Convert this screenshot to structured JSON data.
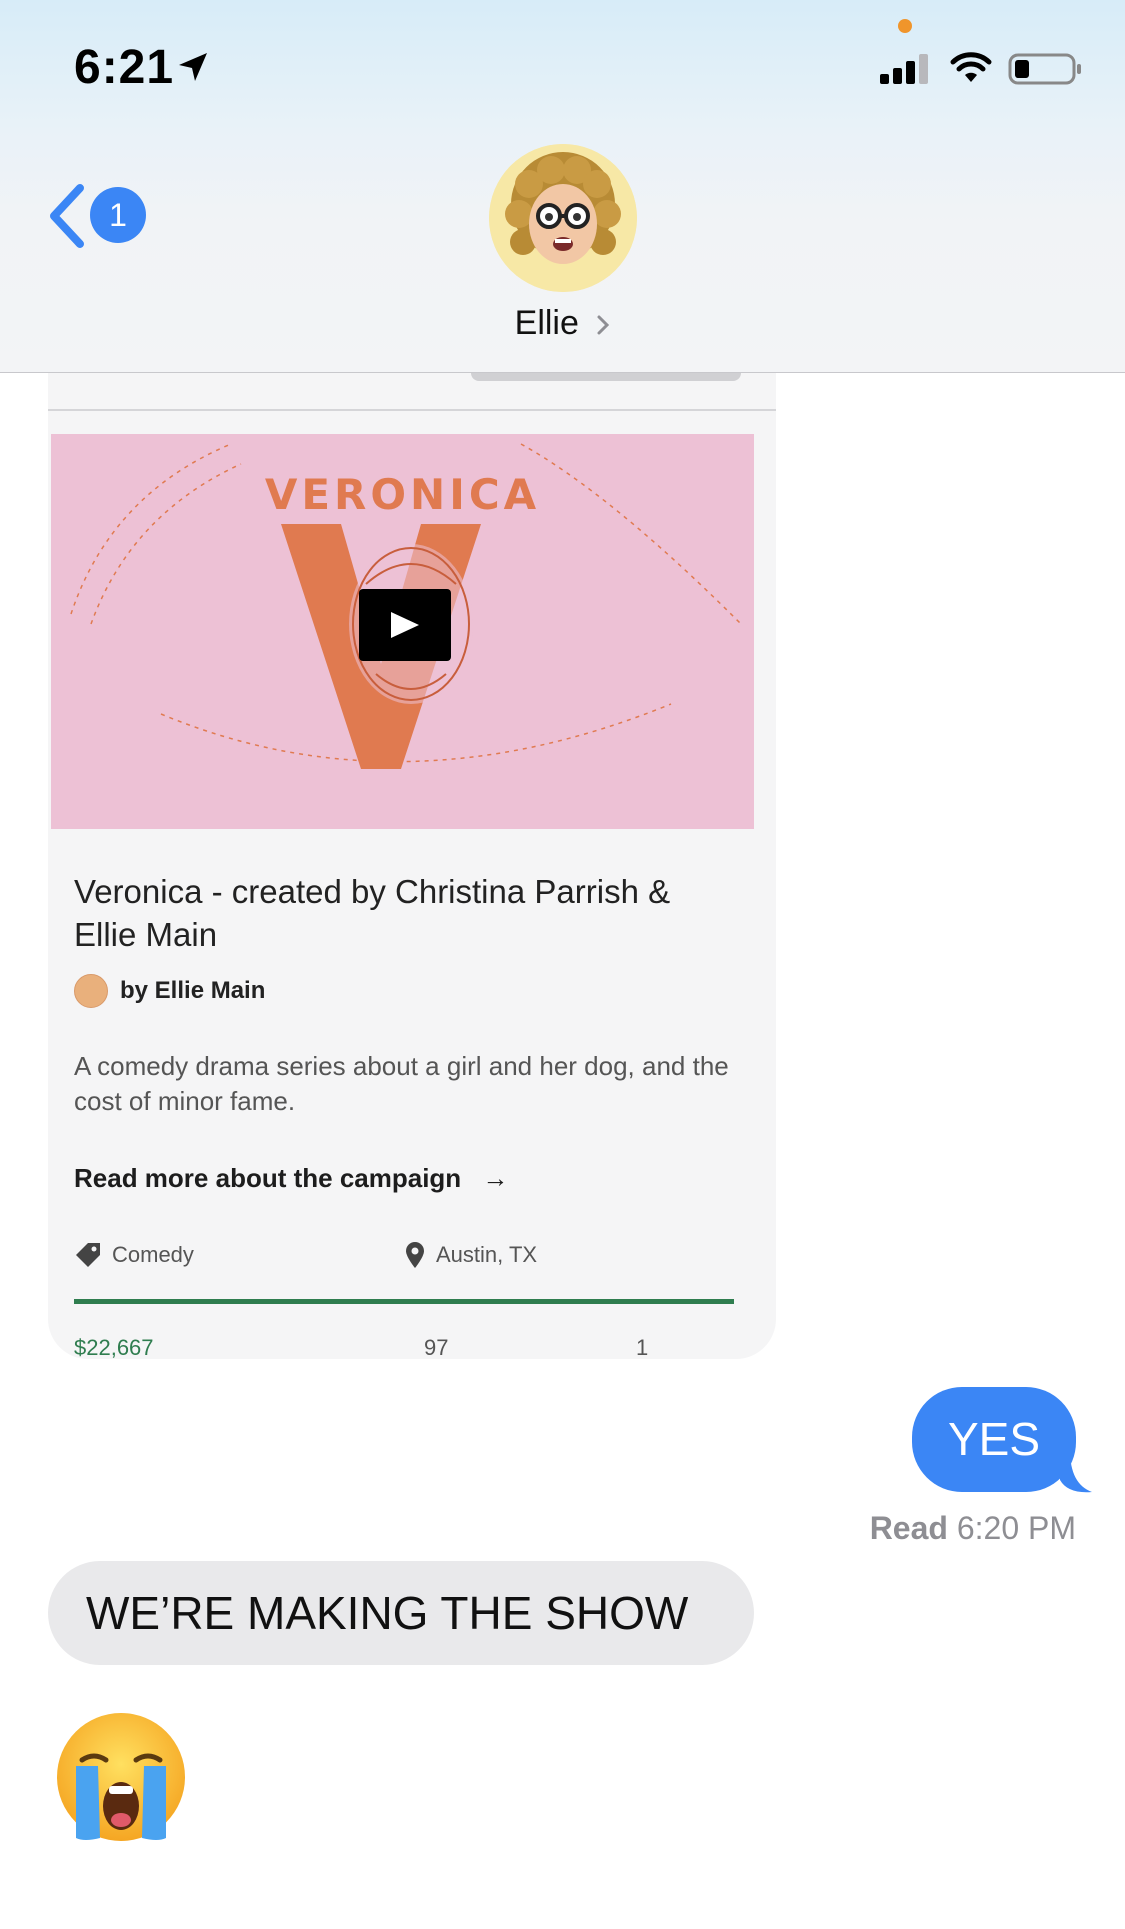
{
  "status_bar": {
    "time": "6:21",
    "location_icon": "location-arrow-icon",
    "signal_icon": "cellular-signal-icon",
    "wifi_icon": "wifi-icon",
    "battery_icon": "battery-icon"
  },
  "nav": {
    "back_badge": "1",
    "contact_name": "Ellie"
  },
  "link_card": {
    "hero_title": "VERONICA",
    "title": "Veronica - created by Christina Parrish & Ellie Main",
    "byline": "by Ellie Main",
    "description": "A comedy drama series about a girl and her dog, and the cost of minor fame.",
    "read_more": "Read more about the campaign",
    "read_more_arrow": "→",
    "category": "Comedy",
    "location": "Austin, TX",
    "stats": [
      "$22,667",
      "97",
      "1"
    ]
  },
  "messages": {
    "outgoing_text": "YES",
    "read_label": "Read",
    "read_time": "6:20 PM",
    "incoming_text": "WE’RE MAKING THE SHOW",
    "emoji": "😭"
  },
  "colors": {
    "imessage_blue": "#3b86f5",
    "incoming_gray": "#e9e9eb",
    "kickstarter_green": "#2f7d4f",
    "hero_pink": "#edc1d5",
    "hero_orange": "#e07a50"
  }
}
